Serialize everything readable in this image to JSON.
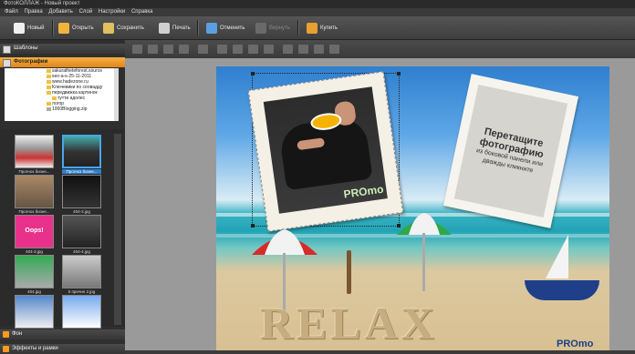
{
  "window": {
    "title": "ФотоКОЛЛАЖ - Новый проект"
  },
  "menu": [
    "Файл",
    "Правка",
    "Добавить",
    "Слой",
    "Настройки",
    "Справка"
  ],
  "toolbar": {
    "new": "Новый",
    "open": "Открыть",
    "save": "Сохранить",
    "print": "Печать",
    "undo": "Отменить",
    "redo": "Вернуть",
    "buy": "Купить"
  },
  "left_panel": {
    "templates_header": "Шаблоны",
    "photos_header": "Фотографии",
    "tree": [
      "sakuratheteforest.source",
      "seo-a-s-25-11-2011",
      "www.hadezone.ru",
      "Ключевики по сеовадду",
      "передвижка картинок",
      "тутти адолес",
      "логор",
      "1000Blogging.zip"
    ],
    "thumbs": [
      {
        "caption": "Прогноз бизне...",
        "selected": false
      },
      {
        "caption": "Прогноз бизне...",
        "selected": true
      },
      {
        "caption": "Прогноз бизне...",
        "selected": false
      },
      {
        "caption": "404-2.jpg",
        "selected": false
      },
      {
        "caption": "404-3.jpg",
        "selected": false
      },
      {
        "caption": "404-4.jpg",
        "selected": false
      },
      {
        "caption": "404.jpg",
        "selected": false
      },
      {
        "caption": "5 причин 2.jpg",
        "selected": false
      },
      {
        "caption": "",
        "selected": false
      },
      {
        "caption": "",
        "selected": false
      }
    ],
    "thumb_badge": "Oops!",
    "background_header": "Фон",
    "effects_header": "Эффекты и рамки"
  },
  "canvas": {
    "stamp_title": "Перетащите фотографию",
    "stamp_sub": "из боковой панели или дважды кликните",
    "relax": "RELAX",
    "promo_badge": "PROmo",
    "promo_badge_2": "PROmo"
  },
  "colors": {
    "accent": "#f0a030",
    "selection": "#2d7fd0"
  }
}
